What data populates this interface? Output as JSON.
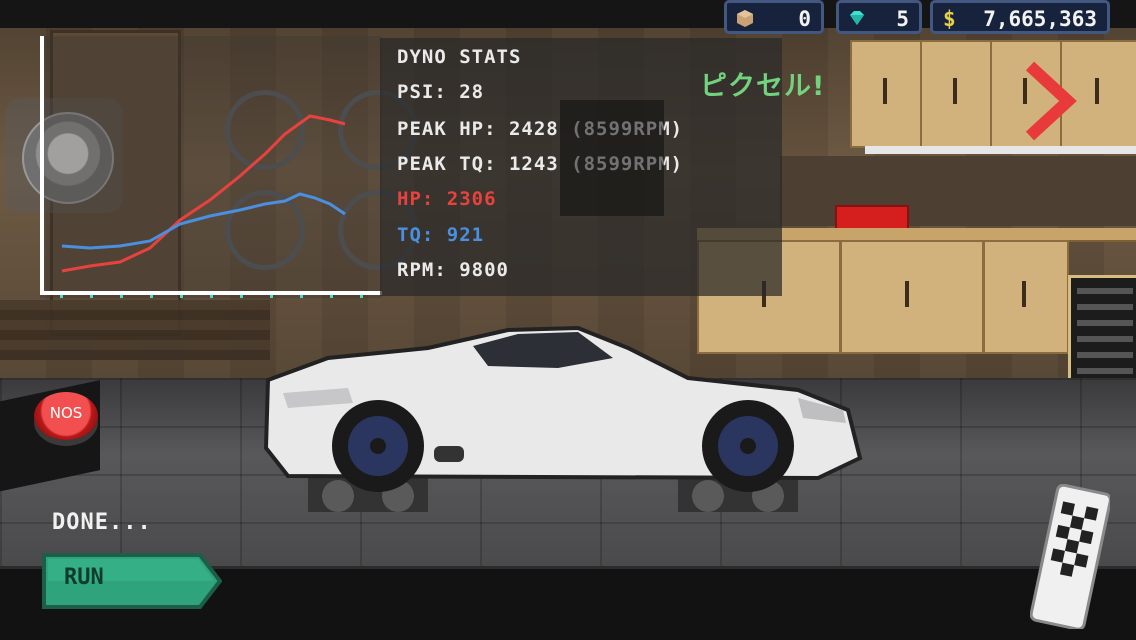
{
  "currencies": {
    "crates": {
      "icon": "crate-icon",
      "value": "0"
    },
    "gems": {
      "icon": "gem-icon",
      "value": "5"
    },
    "cash": {
      "icon": "dollar-icon",
      "symbol": "$",
      "value": "7,665,363"
    }
  },
  "dyno": {
    "title": "DYNO STATS",
    "psi": "PSI: 28",
    "peak_hp": "PEAK HP: 2428 (8599RPM)",
    "peak_tq": "PEAK TQ: 1243 (8599RPM)",
    "hp": "HP: 2306",
    "tq": "TQ: 921",
    "rpm": "RPM: 9800"
  },
  "watermark": "ピクセル!",
  "status_text": "DONE...",
  "run_label": "RUN",
  "nos_label": "NOS",
  "icons": {
    "next": "chevron-right-icon",
    "finish": "checkered-flag-icon",
    "joystick": "joystick-icon"
  },
  "colors": {
    "hp_line": "#e8423f",
    "tq_line": "#4a8fe0",
    "run_button": "#2fa37c",
    "nos_button": "#d42b2b"
  }
}
